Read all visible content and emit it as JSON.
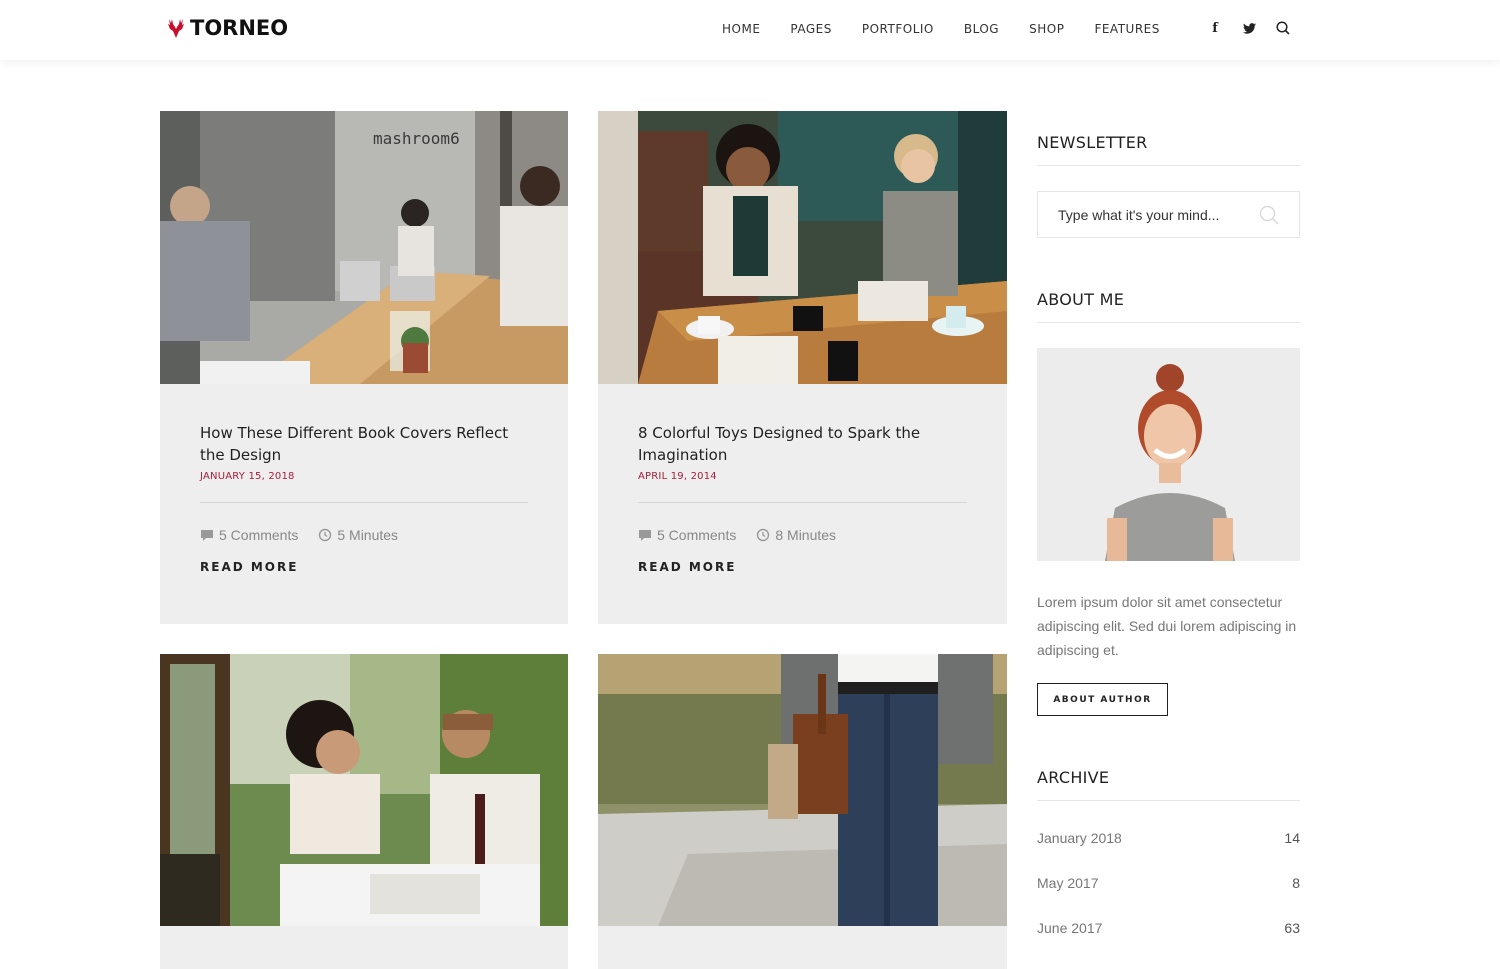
{
  "brand": {
    "name": "TORNEO",
    "accent": "#c8102e"
  },
  "nav": {
    "items": [
      "HOME",
      "PAGES",
      "PORTFOLIO",
      "BLOG",
      "SHOP",
      "FEATURES"
    ],
    "icons": [
      "facebook-icon",
      "twitter-icon",
      "search-icon"
    ]
  },
  "posts": [
    {
      "title": "How These Different Book Covers Reflect the Design",
      "date": "JANUARY 15, 2018",
      "comments": "5 Comments",
      "duration": "5 Minutes",
      "read_more": "READ MORE",
      "sign_text": "mashroom6"
    },
    {
      "title": "8 Colorful Toys Designed to Spark the Imagination",
      "date": "APRIL 19, 2014",
      "comments": "5 Comments",
      "duration": "8 Minutes",
      "read_more": "READ MORE"
    },
    {
      "title": "",
      "date": ""
    },
    {
      "title": "",
      "date": ""
    }
  ],
  "sidebar": {
    "newsletter": {
      "title": "NEWSLETTER",
      "placeholder": "Type what it's your mind..."
    },
    "about": {
      "title": "ABOUT ME",
      "text": "Lorem ipsum dolor sit amet consectetur adipiscing elit. Sed dui lorem adipiscing in adipiscing et.",
      "button": "ABOUT AUTHOR"
    },
    "archive": {
      "title": "ARCHIVE",
      "items": [
        {
          "label": "January 2018",
          "count": "14"
        },
        {
          "label": "May 2017",
          "count": "8"
        },
        {
          "label": "June 2017",
          "count": "63"
        }
      ]
    }
  }
}
